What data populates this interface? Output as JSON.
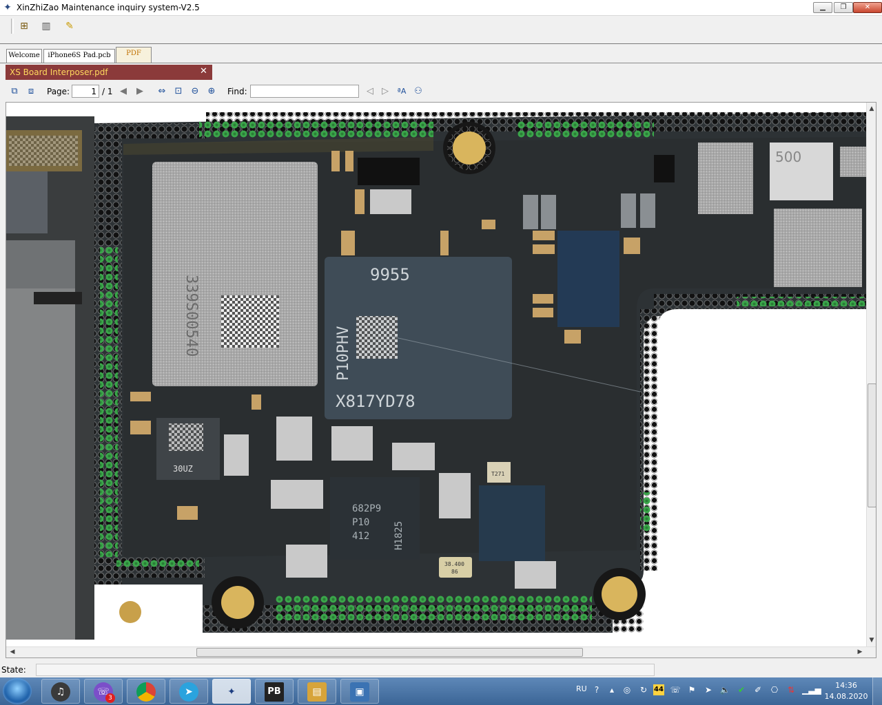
{
  "window": {
    "title": "XinZhiZao Maintenance inquiry system-V2.5",
    "icon": "compass-star-icon",
    "controls": {
      "minimize": "▁",
      "restore": "❐",
      "close": "✕"
    }
  },
  "toolbar": {
    "items": [
      {
        "name": "tree-view-icon",
        "glyph": "🗂"
      },
      {
        "name": "panel-view-icon",
        "glyph": "▥"
      },
      {
        "name": "edit-note-icon",
        "glyph": "✎"
      }
    ]
  },
  "tabs": {
    "items": [
      {
        "label": "Welcome",
        "active": false
      },
      {
        "label": "iPhone6S Pad.pcb",
        "active": false
      },
      {
        "label": "PDF",
        "active": true
      }
    ],
    "document": {
      "label": "XS Board Interposer.pdf",
      "close": "✕"
    }
  },
  "pdf_toolbar": {
    "page_label": "Page:",
    "page_value": "1",
    "page_total": "/ 1",
    "find_label": "Find:",
    "find_value": "",
    "icons": [
      "copy-page-icon",
      "paste-page-icon",
      "prev-page-icon",
      "next-page-icon",
      "fit-width-icon",
      "fit-page-icon",
      "zoom-out-icon",
      "zoom-in-icon",
      "find-prev-icon",
      "find-next-icon",
      "match-case-icon",
      "binoculars-icon"
    ]
  },
  "board": {
    "chip_labels": {
      "main_soc": [
        "9955",
        "P10PHV",
        "X817YD78"
      ],
      "rf_module": "339S00540",
      "pmic": [
        "682P9",
        "P10",
        "412",
        "H1825"
      ],
      "crystal": [
        "38.400",
        "86"
      ],
      "small_chip": "500",
      "left_chip": "30UZ",
      "tag": "T271"
    }
  },
  "status": {
    "label": "State:",
    "value": ""
  },
  "taskbar": {
    "apps": [
      {
        "name": "headset-app-icon",
        "glyph": "🎧",
        "color": "#3a3a3a"
      },
      {
        "name": "viber-app-icon",
        "glyph": "☏",
        "color": "#7b4fc9",
        "badge": "3"
      },
      {
        "name": "chrome-app-icon",
        "glyph": "◉",
        "color": "#db4437"
      },
      {
        "name": "telegram-app-icon",
        "glyph": "➤",
        "color": "#2aa3de"
      },
      {
        "name": "xinzhizao-app-icon",
        "glyph": "✦",
        "color": "#1c3d80"
      },
      {
        "name": "pb-app-icon",
        "glyph": "PB",
        "color": "#222222"
      },
      {
        "name": "explorer-app-icon",
        "glyph": "📁",
        "color": "#d7a43a"
      },
      {
        "name": "photo-viewer-app-icon",
        "glyph": "🖼",
        "color": "#3b73b3"
      }
    ],
    "tray": {
      "lang": "RU",
      "badge_44": "44",
      "time": "14:36",
      "date": "14.08.2020"
    }
  }
}
